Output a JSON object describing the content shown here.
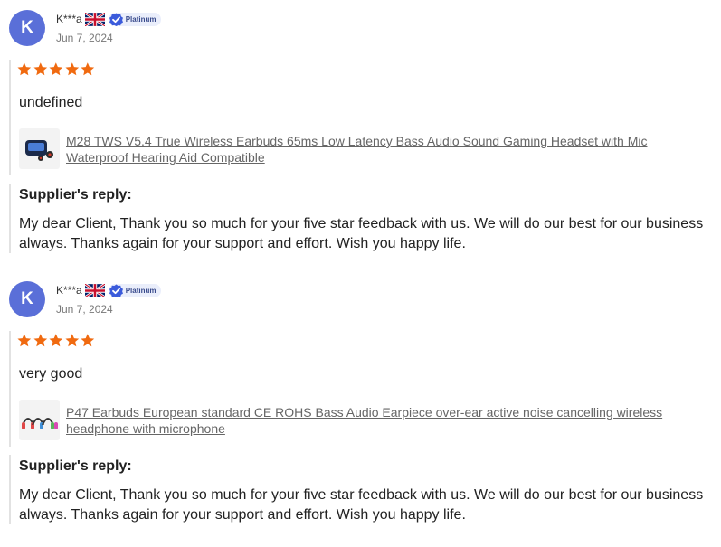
{
  "reviews": [
    {
      "avatar_letter": "K",
      "reviewer_name": "K***a",
      "flag_icon": "uk-flag-icon",
      "badge_label": "Platinum",
      "date": "Jun 7, 2024",
      "rating": 5,
      "rating_color": "#f06a10",
      "text": "undefined",
      "product_title": "M28 TWS V5.4 True Wireless Earbuds 65ms Low Latency Bass Audio Sound Gaming Headset with Mic Waterproof Hearing Aid Compatible",
      "reply_title": "Supplier's reply:",
      "reply_text": "My dear Client, Thank you so much for your five star feedback with us. We will do our best for our business always. Thanks again for your support and effort. Wish you happy life."
    },
    {
      "avatar_letter": "K",
      "reviewer_name": "K***a",
      "flag_icon": "uk-flag-icon",
      "badge_label": "Platinum",
      "date": "Jun 7, 2024",
      "rating": 5,
      "rating_color": "#f06a10",
      "text": "very good",
      "product_title": "P47 Earbuds European standard CE ROHS Bass Audio Earpiece over-ear active noise cancelling wireless headphone with microphone",
      "reply_title": "Supplier's reply:",
      "reply_text": "My dear Client, Thank you so much for your five star feedback with us. We will do our best for our business always. Thanks again for your support and effort. Wish you happy life."
    }
  ],
  "colors": {
    "avatar_bg": "#5a6fd8",
    "star": "#f06a10",
    "badge_bg": "#eaeefb",
    "badge_text": "#384a8c"
  }
}
